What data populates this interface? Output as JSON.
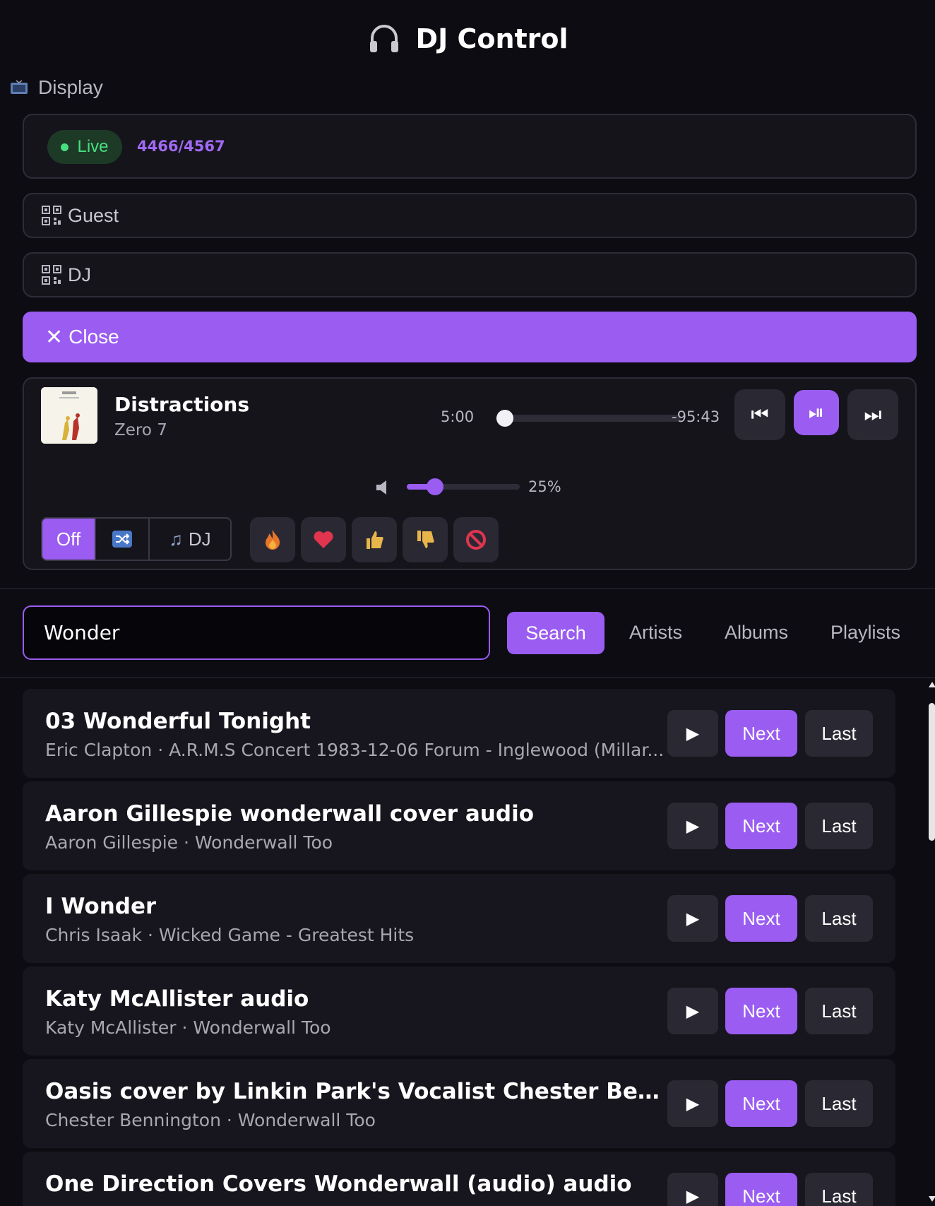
{
  "app": {
    "title": "DJ Control"
  },
  "display": {
    "label": "Display"
  },
  "status": {
    "live_label": "Live",
    "count": "4466/4567"
  },
  "links": {
    "guest_label": "Guest",
    "dj_label": "DJ"
  },
  "close": {
    "label": "Close"
  },
  "now_playing": {
    "title": "Distractions",
    "artist": "Zero 7",
    "elapsed": "5:00",
    "remaining": "-95:43",
    "progress_fraction": 0.05,
    "volume_percent": 25,
    "volume_label": "25%"
  },
  "modes": {
    "off_label": "Off",
    "dj_label": "DJ",
    "active": "off"
  },
  "reactions": [
    "fire-icon",
    "heart-icon",
    "thumbs-up-icon",
    "thumbs-down-icon",
    "prohibited-icon"
  ],
  "search": {
    "value": "Wonder",
    "button_label": "Search"
  },
  "tabs": [
    {
      "label": "Artists"
    },
    {
      "label": "Albums"
    },
    {
      "label": "Playlists"
    }
  ],
  "results": [
    {
      "title": "03 Wonderful Tonight",
      "subtitle": "Eric Clapton · A.R.M.S Concert 1983-12-06 Forum - Inglewood (Millar...",
      "next_label": "Next",
      "last_label": "Last"
    },
    {
      "title": "Aaron Gillespie wonderwall cover audio",
      "subtitle": "Aaron Gillespie · Wonderwall Too",
      "next_label": "Next",
      "last_label": "Last"
    },
    {
      "title": "I Wonder",
      "subtitle": "Chris Isaak · Wicked Game - Greatest Hits",
      "next_label": "Next",
      "last_label": "Last"
    },
    {
      "title": "Katy McAllister audio",
      "subtitle": "Katy McAllister · Wonderwall Too",
      "next_label": "Next",
      "last_label": "Last"
    },
    {
      "title": "Oasis cover by Linkin Park's Vocalist Chester Bennington ...",
      "subtitle": "Chester Bennington · Wonderwall Too",
      "next_label": "Next",
      "last_label": "Last"
    },
    {
      "title": "One Direction Covers Wonderwall (audio) audio",
      "subtitle": "",
      "next_label": "Next",
      "last_label": "Last"
    }
  ],
  "colors": {
    "accent": "#9a5cf1",
    "live": "#4ade80",
    "background": "#0d0c12",
    "panel": "#15141b"
  }
}
